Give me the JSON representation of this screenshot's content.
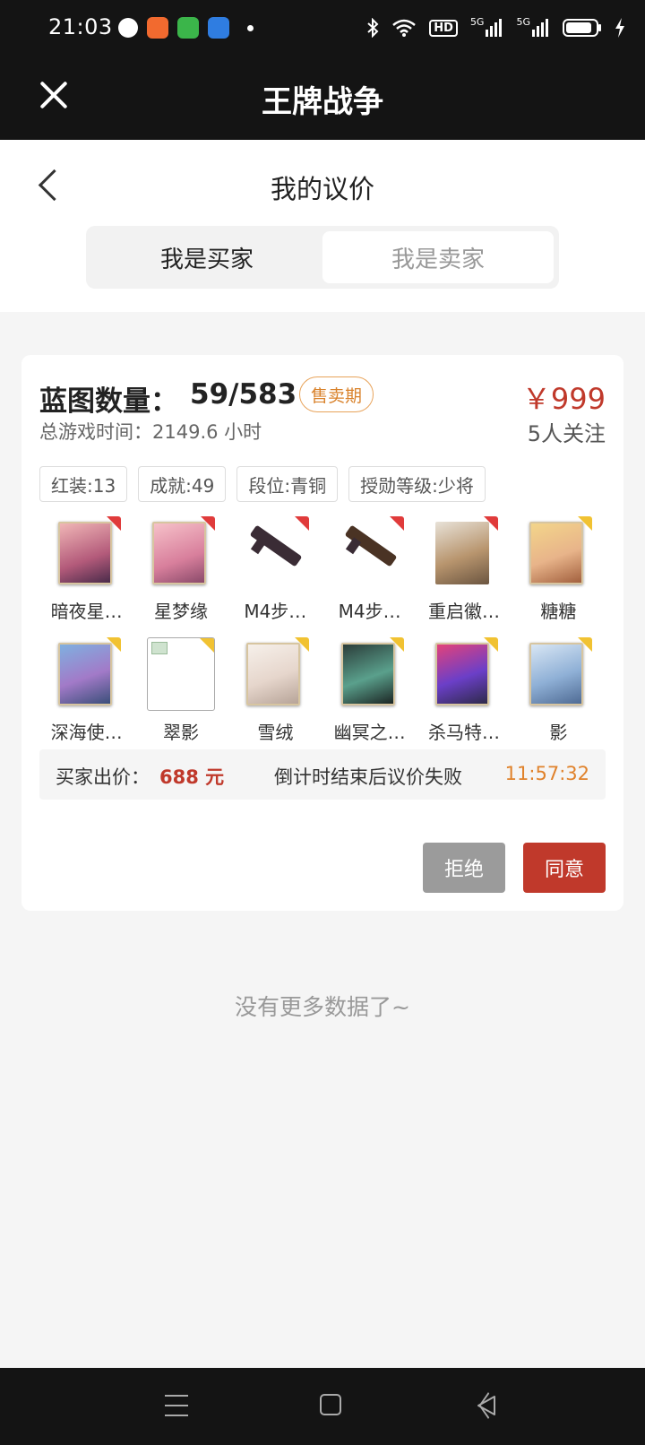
{
  "status_bar": {
    "time": "21:03",
    "notification_icons": [
      "wechat-icon",
      "app-store-icon",
      "messages-icon",
      "browser-icon"
    ],
    "right_icons": [
      "bluetooth-icon",
      "wifi-icon",
      "hd-icon",
      "signal-5g-icon",
      "signal-5g-icon",
      "battery-icon",
      "charging-icon"
    ],
    "hd_text": "HD",
    "sig1_text": "5G",
    "sig2_text": "5G"
  },
  "app_bar": {
    "title": "王牌战争"
  },
  "header": {
    "title": "我的议价",
    "tabs": [
      {
        "label": "我是买家"
      },
      {
        "label": "我是卖家"
      }
    ]
  },
  "listing": {
    "blueprint_label": "蓝图数量：",
    "blueprint_value": "59/583",
    "status_tag": "售卖期",
    "price": "￥999",
    "playtime": "总游戏时间：2149.6 小时",
    "followers": "5人关注",
    "chips": [
      {
        "label": "红装:13"
      },
      {
        "label": "成就:49"
      },
      {
        "label": "段位:青铜"
      },
      {
        "label": "授勋等级:少将"
      }
    ],
    "items": [
      {
        "label": "暗夜星…",
        "corner": "red"
      },
      {
        "label": "星梦缘",
        "corner": "red"
      },
      {
        "label": "M4步…",
        "corner": "red"
      },
      {
        "label": "M4步…",
        "corner": "red"
      },
      {
        "label": "重启徽…",
        "corner": "red"
      },
      {
        "label": "糖糖",
        "corner": "gold"
      },
      {
        "label": "深海使…",
        "corner": "gold"
      },
      {
        "label": "翠影",
        "corner": "gold"
      },
      {
        "label": "雪绒",
        "corner": "gold"
      },
      {
        "label": "幽冥之…",
        "corner": "gold"
      },
      {
        "label": "杀马特…",
        "corner": "gold"
      },
      {
        "label": "影",
        "corner": "gold"
      }
    ],
    "offer": {
      "label": "买家出价：",
      "amount": "688 元",
      "note": "倒计时结束后议价失败",
      "timer": "11:57:32"
    },
    "buttons": {
      "reject": "拒绝",
      "agree": "同意"
    }
  },
  "footer_text": "没有更多数据了~",
  "colors": {
    "accent_red": "#c0392b",
    "timer_orange": "#e0822b",
    "tag_orange": "#d9822b",
    "dark_bar": "#141414"
  }
}
